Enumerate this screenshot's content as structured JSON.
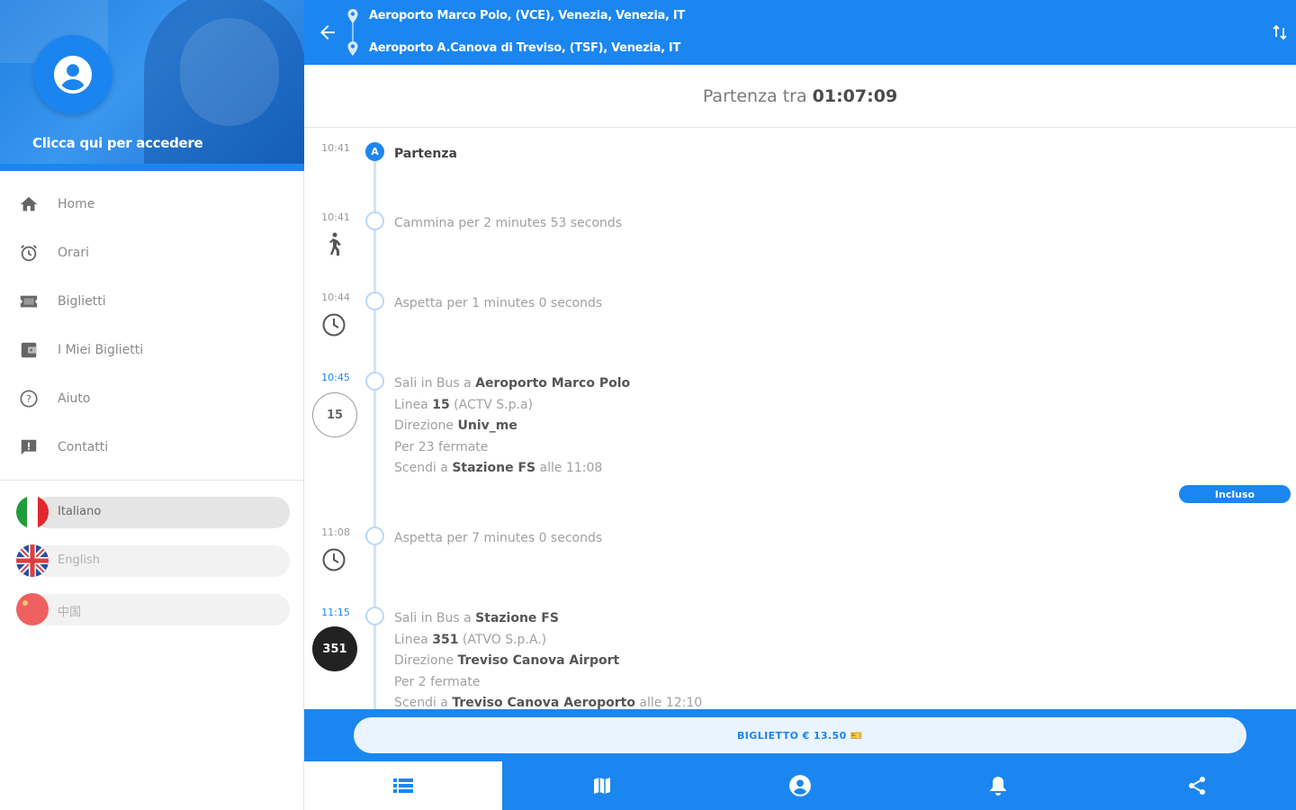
{
  "sidebar": {
    "login_text": "Clicca qui per accedere",
    "menu": [
      {
        "label": "Home",
        "icon": "home-icon"
      },
      {
        "label": "Orari",
        "icon": "alarm-icon"
      },
      {
        "label": "Biglietti",
        "icon": "ticket-icon"
      },
      {
        "label": "I Miei Biglietti",
        "icon": "wallet-icon"
      },
      {
        "label": "Aiuto",
        "icon": "help-icon"
      },
      {
        "label": "Contatti",
        "icon": "feedback-icon"
      }
    ],
    "languages": [
      {
        "label": "Italiano",
        "flag": "italy-flag",
        "selected": true
      },
      {
        "label": "English",
        "flag": "uk-flag",
        "selected": false
      },
      {
        "label": "中国",
        "flag": "china-flag",
        "selected": false
      }
    ]
  },
  "route": {
    "from": "Aeroporto Marco Polo, (VCE), Venezia, Venezia, IT",
    "to": "Aeroporto A.Canova di Treviso, (TSF), Venezia, IT"
  },
  "countdown": {
    "prefix": "Partenza tra",
    "value": "01:07:09"
  },
  "steps": {
    "start": {
      "time": "10:41",
      "marker": "A",
      "label": "Partenza"
    },
    "walk": {
      "time": "10:41",
      "text": "Cammina per 2 minutes 53 seconds"
    },
    "wait1": {
      "time": "10:44",
      "text": "Aspetta per 1 minutes 0 seconds"
    },
    "bus1": {
      "time": "10:45",
      "line": "15",
      "l1_pre": "Sali in Bus a ",
      "l1_b": "Aeroporto Marco Polo",
      "l2_pre": "Linea ",
      "l2_b": "15",
      "l2_post": " (ACTV S.p.a)",
      "l3_pre": "Direzione ",
      "l3_b": "Univ_me",
      "l4": "Per 23 fermate",
      "l5_pre": "Scendi a ",
      "l5_b": "Stazione FS",
      "l5_post": " alle 11:08",
      "badge": "Incluso"
    },
    "wait2": {
      "time": "11:08",
      "text": "Aspetta per 7 minutes 0 seconds"
    },
    "bus2": {
      "time": "11:15",
      "line": "351",
      "l1_pre": "Sali in Bus a ",
      "l1_b": "Stazione FS",
      "l2_pre": "Linea ",
      "l2_b": "351",
      "l2_post": " (ATVO S.p.A.)",
      "l3_pre": "Direzione ",
      "l3_b": "Treviso Canova Airport",
      "l4": "Per 2 fermate",
      "l5_pre": "Scendi a ",
      "l5_b": "Treviso Canova Aeroporto",
      "l5_post": " alle 12:10"
    }
  },
  "ticket_button": "BIGLIETTO € 13.50 🎫",
  "bottom_nav": [
    {
      "icon": "list-icon",
      "active": true
    },
    {
      "icon": "map-icon",
      "active": false
    },
    {
      "icon": "account-icon",
      "active": false
    },
    {
      "icon": "bell-icon",
      "active": false
    },
    {
      "icon": "share-icon",
      "active": false
    }
  ],
  "colors": {
    "primary": "#1b86f0",
    "timeline": "#cfe5fb",
    "text_muted": "#a0a0a0"
  }
}
